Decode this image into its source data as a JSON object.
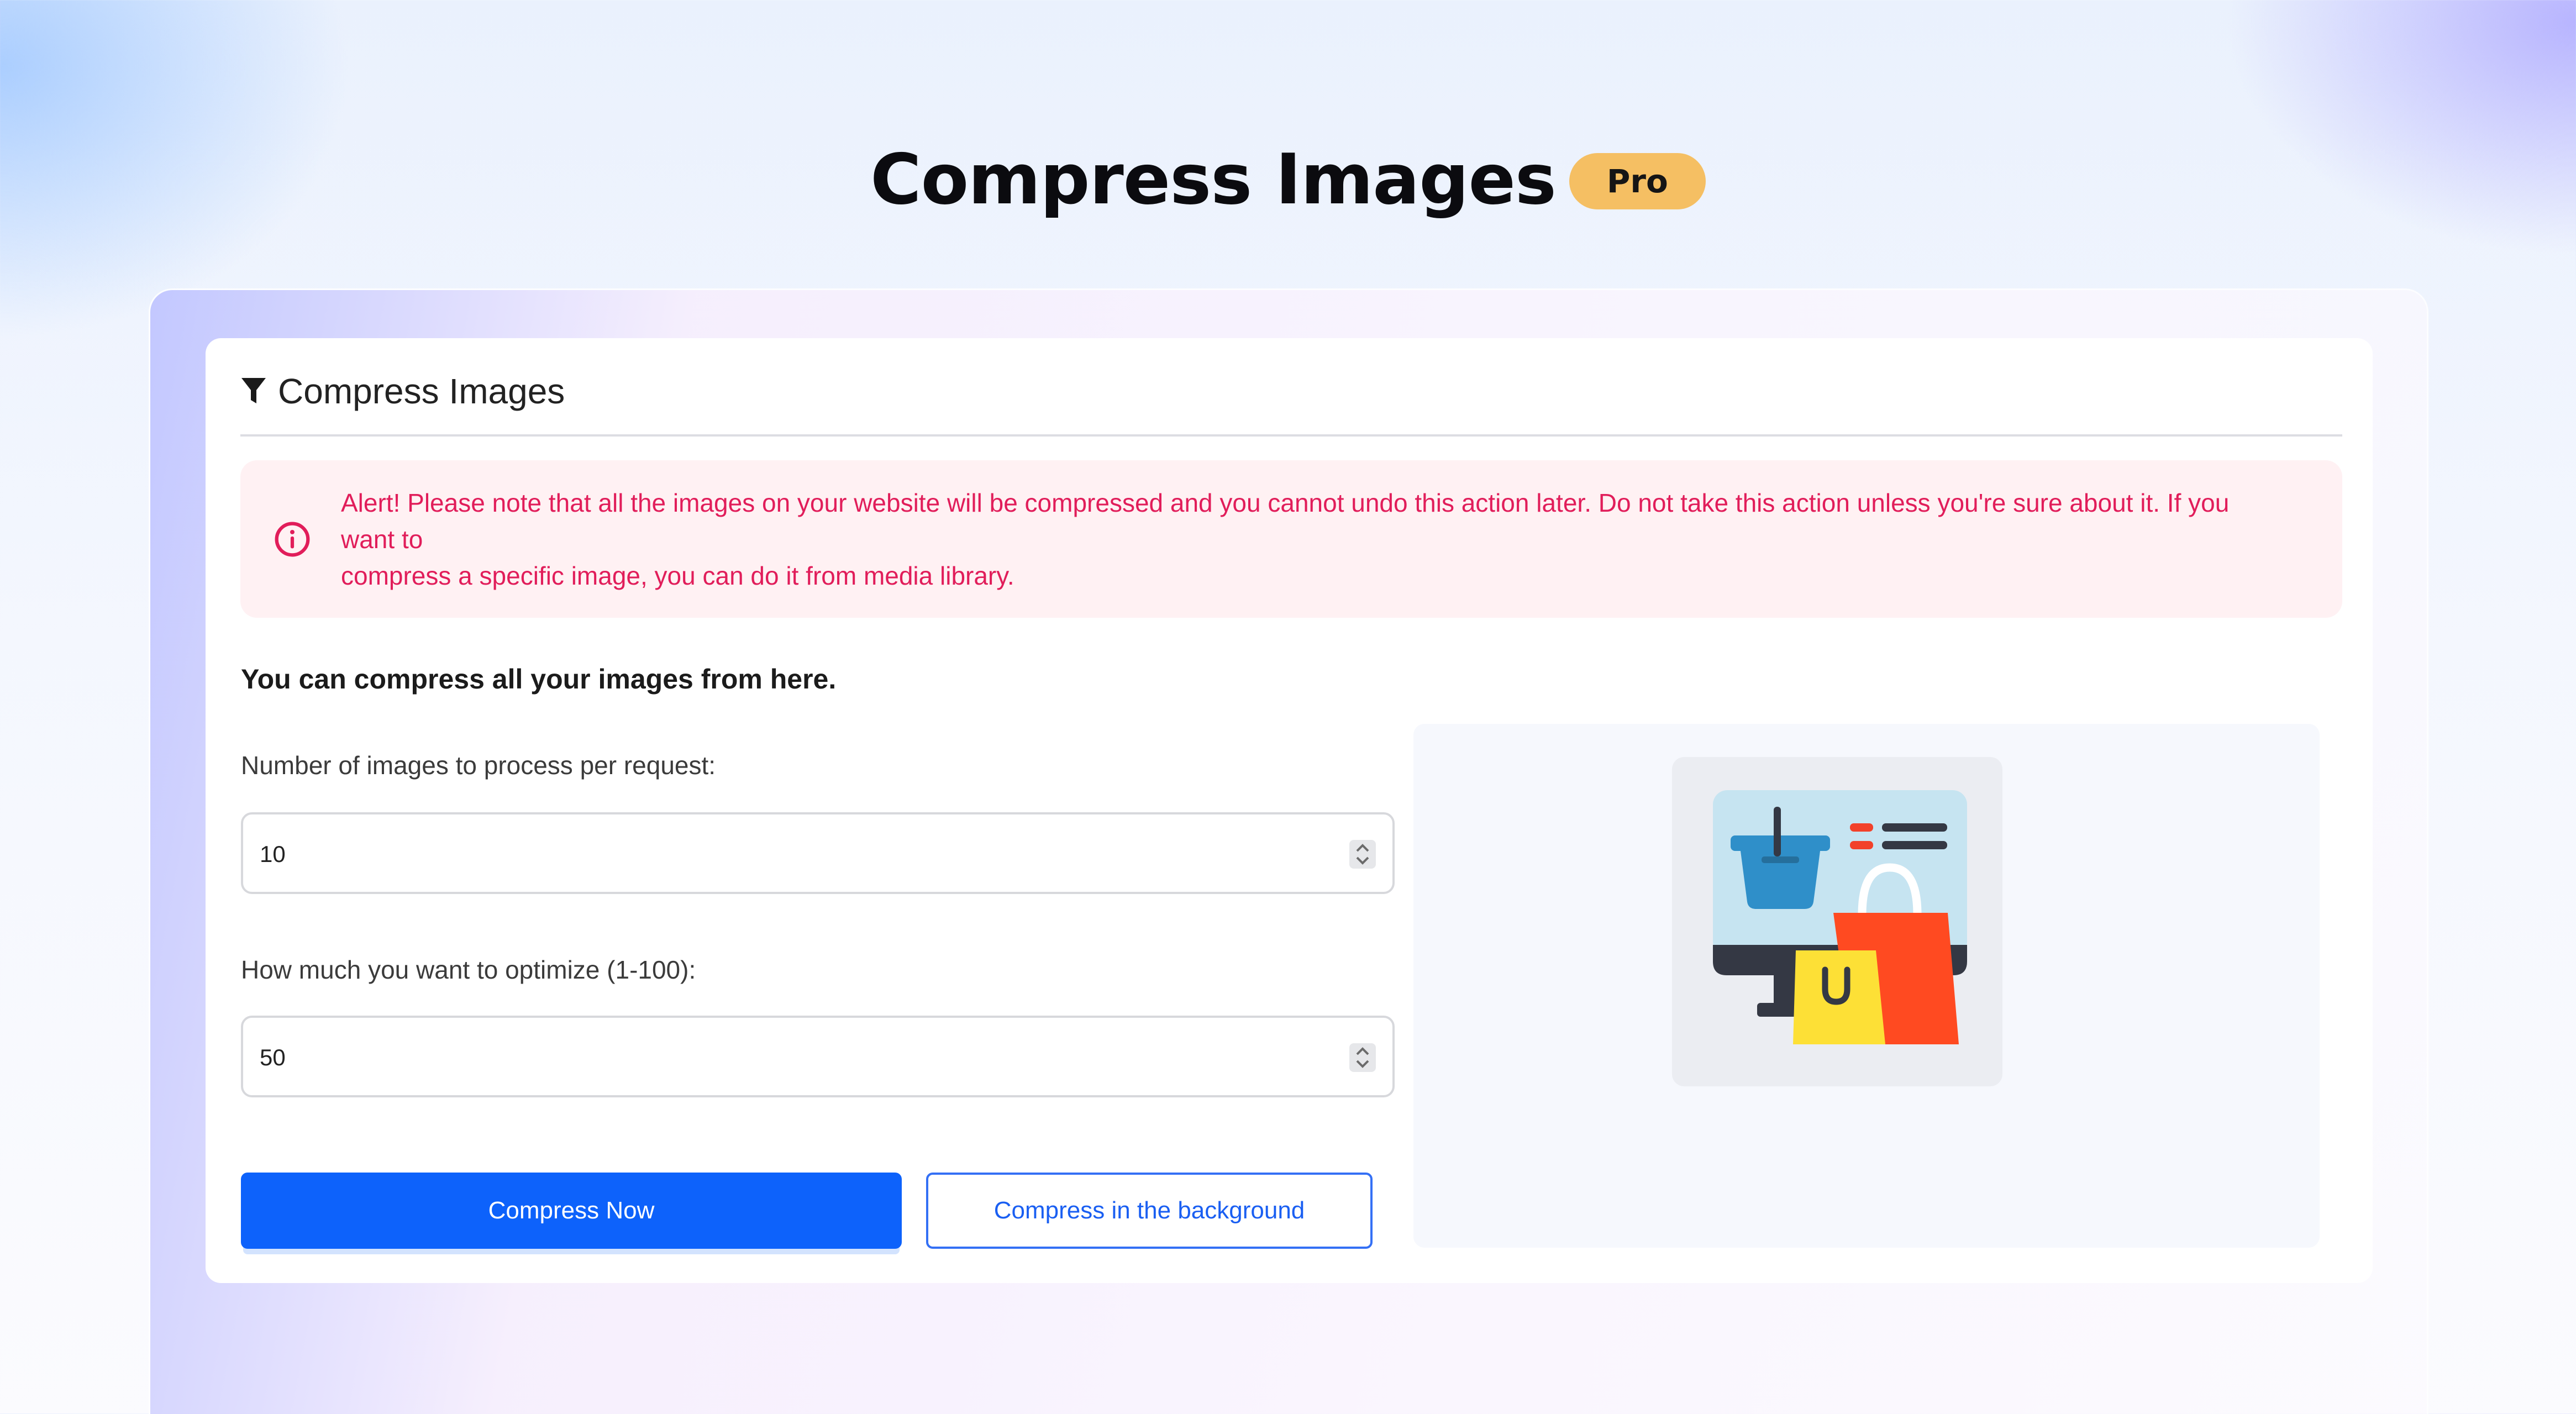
{
  "header": {
    "title": "Compress Images",
    "badge": "Pro"
  },
  "card": {
    "title": "Compress Images",
    "title_icon": "filter-icon"
  },
  "alert": {
    "icon": "info-circle-icon",
    "line1": "Alert! Please note that all the images on your website will be compressed and you cannot undo this action later. Do not take this action unless you're sure about it. If you want to",
    "line2": "compress a specific image, you can do it from media library."
  },
  "form": {
    "lead": "You can compress all your images from here.",
    "images_per_request": {
      "label": "Number of images to process per request:",
      "value": "10"
    },
    "optimize_level": {
      "label": "How much you want to optimize (1-100):",
      "value": "50"
    },
    "compress_now_label": "Compress Now",
    "compress_background_label": "Compress in the background"
  },
  "illustration": {
    "icon": "shopping-store-monitor-icon"
  },
  "colors": {
    "primary": "#0d62fb",
    "alert_text": "#e11d5a",
    "alert_bg": "#fff1f3",
    "badge": "#f5bf63"
  }
}
